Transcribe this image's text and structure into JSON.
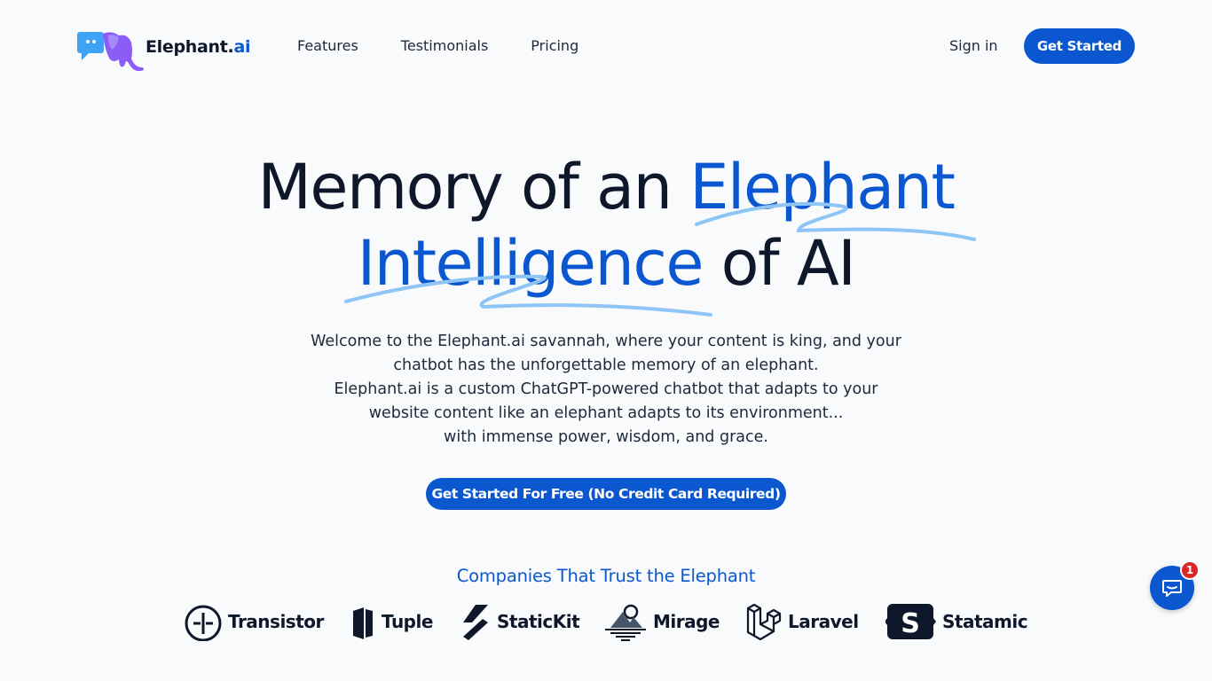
{
  "brand": {
    "name_main": "Elephant.",
    "name_accent": "ai",
    "accent_color": "#0b57d0"
  },
  "nav": {
    "links": [
      {
        "label": "Features"
      },
      {
        "label": "Testimonials"
      },
      {
        "label": "Pricing"
      }
    ],
    "signin_label": "Sign in",
    "get_started_label": "Get Started"
  },
  "hero": {
    "line1_dark": "Memory of an ",
    "line1_blue": "Elephant",
    "line2_blue": "Intelligence",
    "line2_dark": " of AI",
    "lead": [
      "Welcome to the Elephant.ai savannah, where your content is king, and your",
      "chatbot has the unforgettable memory of an elephant.",
      "Elephant.ai is a custom ChatGPT-powered chatbot that adapts to your",
      "website content like an elephant adapts to its environment...",
      "with immense power, wisdom, and grace."
    ],
    "cta_label": "Get Started For Free (No Credit Card Required)"
  },
  "trust": {
    "title": "Companies That Trust the Elephant",
    "companies": [
      {
        "name": "Transistor",
        "icon": "transistor-icon"
      },
      {
        "name": "Tuple",
        "icon": "tuple-icon"
      },
      {
        "name": "StaticKit",
        "icon": "statickit-icon"
      },
      {
        "name": "Mirage",
        "icon": "mirage-icon"
      },
      {
        "name": "Laravel",
        "icon": "laravel-icon"
      },
      {
        "name": "Statamic",
        "icon": "statamic-icon"
      }
    ]
  },
  "chat_widget": {
    "badge_count": "1",
    "icon": "chat-icon"
  }
}
